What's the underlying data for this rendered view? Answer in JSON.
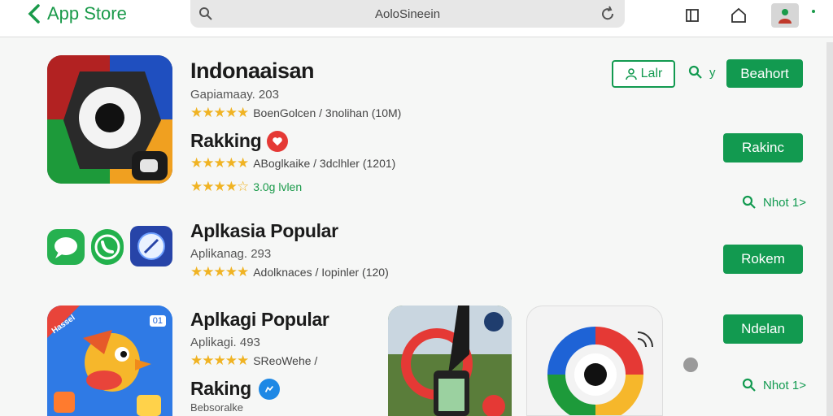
{
  "header": {
    "back_label": "App Store",
    "url_text": "AoloSineein"
  },
  "sections": [
    {
      "title": "Indonaaisan",
      "subtitle": "Gapiamaay. 203",
      "rating_text": "BoenGolcen  /  3nolihan (10M)"
    },
    {
      "title": "Rakking",
      "rating_text": "ABoglkaike  /  3dclhler (1201)",
      "rating2_text": "3.0g lvlen"
    },
    {
      "title": "Aplkasia Popular",
      "subtitle": "Aplikanag. 293",
      "rating_text": "Adolknaces  /  Iopinler (120)"
    },
    {
      "title": "Aplkagi Popular",
      "subtitle": "Aplikagi. 493",
      "rating_text": "SReoWehe /"
    },
    {
      "title": "Raking",
      "subtitle": "Bebsoralke"
    }
  ],
  "buttons": {
    "lalt": "Lalr",
    "search_y": "y",
    "bechort": "Beahort",
    "rakinc": "Rakinc",
    "next1": "Nhot 1>",
    "rokem": "Rokem",
    "ndelan": "Ndelan",
    "next2": "Nhot 1>"
  },
  "icon_texts": {
    "bird_badge": "Hassel",
    "bird_corner": "01"
  },
  "colors": {
    "accent": "#129a50",
    "star": "#f0b323"
  }
}
